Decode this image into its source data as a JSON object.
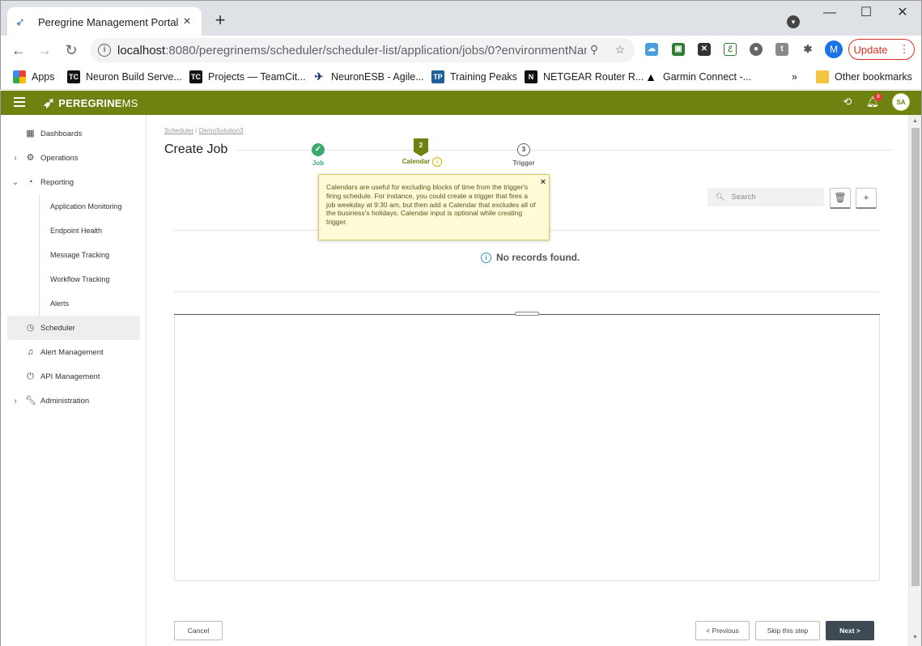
{
  "browser": {
    "tab_title": "Peregrine Management Portal",
    "url_host": "localhost",
    "url_path": ":8080/peregrinems/scheduler/scheduler-list/application/jobs/0?environmentNam...",
    "update_label": "Update",
    "profile_initial": "M",
    "bookmarks": [
      {
        "label": "Apps",
        "icon_text": "",
        "color": "#e94235"
      },
      {
        "label": "Neuron Build Serve...",
        "icon_text": "TC",
        "color": "#111111"
      },
      {
        "label": "Projects — TeamCit...",
        "icon_text": "TC",
        "color": "#111111"
      },
      {
        "label": "NeuronESB - Agile...",
        "icon_text": "",
        "color": "#1b3c73"
      },
      {
        "label": "Training Peaks",
        "icon_text": "TP",
        "color": "#1c5f99"
      },
      {
        "label": "NETGEAR Router R...",
        "icon_text": "N",
        "color": "#111111"
      },
      {
        "label": "Garmin Connect -...",
        "icon_text": "",
        "color": "#000000"
      }
    ],
    "more_bookmarks": "»",
    "other_bookmarks": "Other bookmarks"
  },
  "app": {
    "logo_main": "PEREGRINE",
    "logo_suffix": "MS",
    "accent_color": "#6d8210",
    "notification_count": "8",
    "user_initials": "SA"
  },
  "sidebar": {
    "items": [
      {
        "label": "Dashboards",
        "icon": "dashboard-icon"
      },
      {
        "label": "Operations",
        "icon": "gear-icon"
      },
      {
        "label": "Reporting",
        "icon": "chart-icon"
      },
      {
        "label": "Scheduler",
        "icon": "clock-icon"
      },
      {
        "label": "Alert Management",
        "icon": "bell-icon"
      },
      {
        "label": "API Management",
        "icon": "plug-icon"
      },
      {
        "label": "Administration",
        "icon": "wrench-icon"
      }
    ],
    "reporting_sub": [
      "Application Monitoring",
      "Endpoint Health",
      "Message Tracking",
      "Workflow Tracking",
      "Alerts"
    ]
  },
  "main": {
    "breadcrumb_root": "Scheduler",
    "breadcrumb_sep": " / ",
    "breadcrumb_leaf": "DemoSolution3",
    "title": "Create Job",
    "steps": [
      {
        "number": "✓",
        "label": "Job",
        "state": "done"
      },
      {
        "number": "2",
        "label": "Calendar",
        "state": "active"
      },
      {
        "number": "3",
        "label": "Trigger",
        "state": "pending"
      }
    ],
    "tooltip": "Calendars are useful for excluding blocks of time from the trigger's firing schedule. For instance, you could create a trigger that fires a job weekday at 9:30 am, but then add a Calendar that excludes all of the business's holidays. Calendar input is optional while creating trigger.",
    "search_placeholder": "Search",
    "no_records": "No records found.",
    "buttons": {
      "cancel": "Cancel",
      "previous": "< Previous",
      "skip": "Skip this step",
      "next": "Next >"
    }
  }
}
